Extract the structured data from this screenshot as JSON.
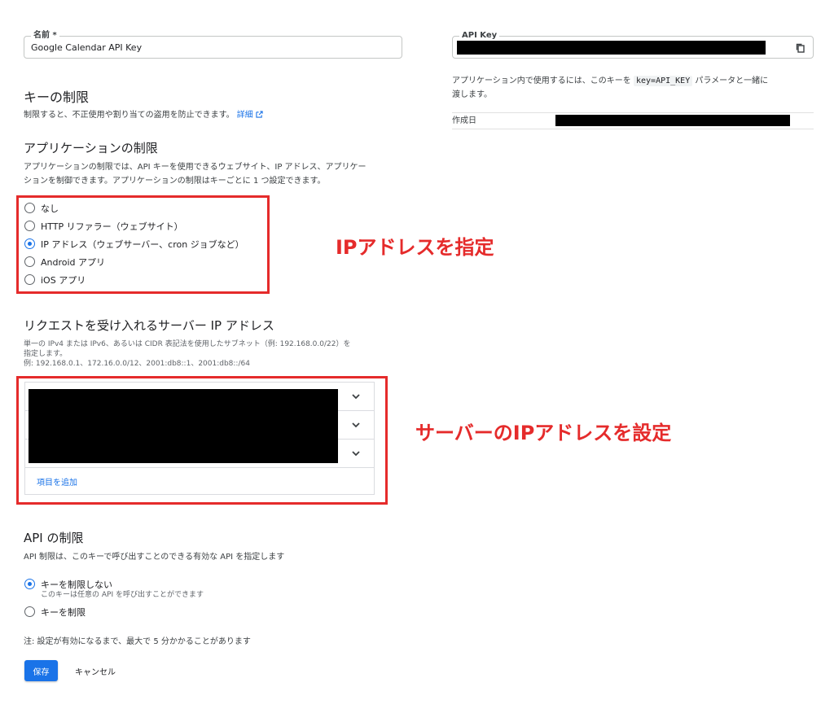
{
  "name_field": {
    "label": "名前 *",
    "value": "Google Calendar API Key"
  },
  "key_restrictions": {
    "title": "キーの制限",
    "description": "制限すると、不正使用や割り当ての盗用を防止できます。",
    "details_link": "詳細"
  },
  "app_restrictions": {
    "title": "アプリケーションの制限",
    "description_line1": "アプリケーションの制限では、API キーを使用できるウェブサイト、IP アドレス、アプリケー",
    "description_line2": "ションを制御できます。アプリケーションの制限はキーごとに 1 つ設定できます。",
    "options": [
      {
        "label": "なし",
        "selected": false
      },
      {
        "label": "HTTP リファラー（ウェブサイト）",
        "selected": false
      },
      {
        "label": "IP アドレス（ウェブサーバー、cron ジョブなど）",
        "selected": true
      },
      {
        "label": "Android アプリ",
        "selected": false
      },
      {
        "label": "iOS アプリ",
        "selected": false
      }
    ]
  },
  "ip_section": {
    "title": "リクエストを受け入れるサーバー IP アドレス",
    "help_line1": "単一の IPv4 または IPv6、あるいは CIDR 表記法を使用したサブネット（例: 192.168.0.0/22）を",
    "help_line2": "指定します。",
    "help_line3": "例: 192.168.0.1、172.16.0.0/12、2001:db8::1、2001:db8::/64",
    "add_item": "項目を追加"
  },
  "api_restrictions": {
    "title": "API の制限",
    "description": "API 制限は、このキーで呼び出すことのできる有効な API を指定します",
    "options": [
      {
        "label": "キーを制限しない",
        "sublabel": "このキーは任意の API を呼び出すことができます",
        "selected": true
      },
      {
        "label": "キーを制限",
        "sublabel": "",
        "selected": false
      }
    ]
  },
  "note": "注: 設定が有効になるまで、最大で 5 分かかることがあります",
  "buttons": {
    "save": "保存",
    "cancel": "キャンセル"
  },
  "api_key_panel": {
    "field_label": "API Key",
    "usage_before": "アプリケーション内で使用するには、このキーを ",
    "usage_code": "key=API_KEY",
    "usage_after": " パラメータと一緒に",
    "usage_line2": "渡します。",
    "created_label": "作成日"
  },
  "annotations": {
    "ip_annotation": "IPアドレスを指定",
    "server_ip_annotation": "サーバーのIPアドレスを設定",
    "color": "#e52b2b"
  },
  "colors": {
    "accent": "#1a73e8",
    "annotation": "#e52b2b"
  },
  "icons": {
    "copy": "copy-icon",
    "chevron": "chevron-down-icon",
    "external_link": "external-link-icon"
  }
}
